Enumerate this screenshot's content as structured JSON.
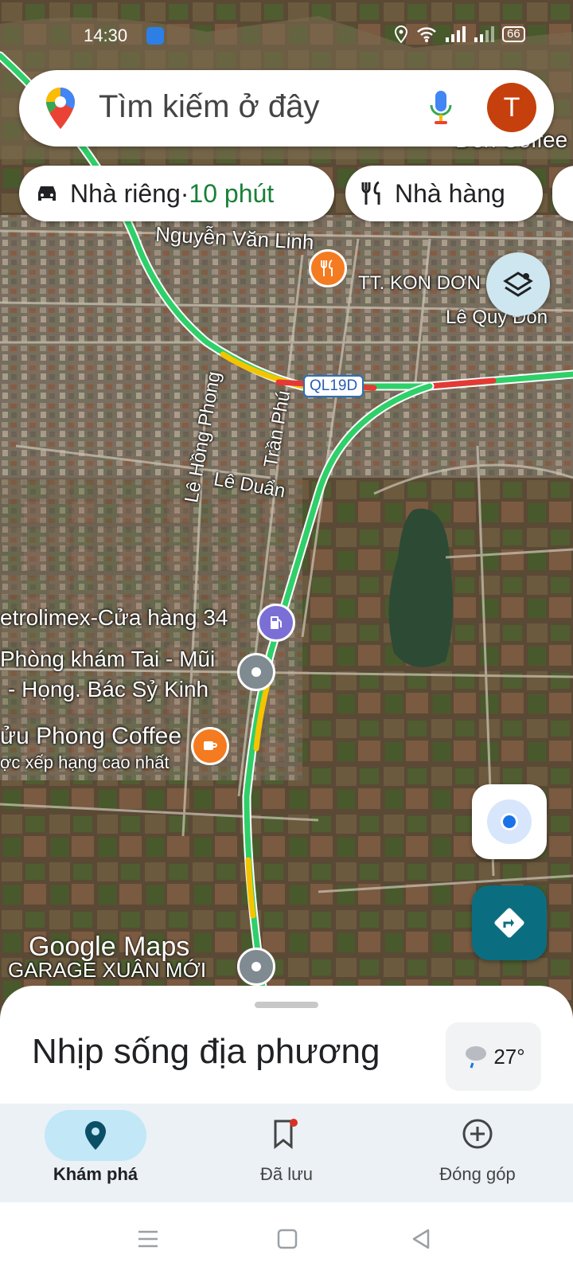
{
  "status_bar": {
    "time": "14:30",
    "battery": "66"
  },
  "search": {
    "placeholder": "Tìm kiếm ở đây",
    "avatar_letter": "T"
  },
  "chips": [
    {
      "label": "Nhà riêng",
      "separator": " · ",
      "extra": "10 phút"
    },
    {
      "label": "Nhà hàng"
    }
  ],
  "map": {
    "labels": [
      "Nguyễn Văn Linh",
      "TT. KON DƠN",
      "Lê Quý Đôn",
      "Lê Hồng Phong",
      "Trần Phú",
      "Lê Duẩn",
      "etrolimex-Cửa hàng 34",
      "Phòng khám Tai - Mũi",
      "- Họng. Bác Sỷ Kinh",
      "ửu Phong Coffee",
      "ợc xếp hạng cao nhất",
      "GARAGE XUÂN MỚI",
      "Đen Coffee"
    ],
    "route_shield": "QL19D",
    "logo": "Google Maps"
  },
  "sheet": {
    "title": "Nhịp sống địa phương",
    "temperature": "27°"
  },
  "bottom_nav": [
    {
      "label": "Khám phá",
      "active": true
    },
    {
      "label": "Đã lưu",
      "active": false
    },
    {
      "label": "Đóng góp",
      "active": false
    }
  ],
  "colors": {
    "accent_teal": "#0b6e80",
    "nav_active_pill": "#c2e7f7",
    "traffic_green": "#2fcf6a"
  }
}
